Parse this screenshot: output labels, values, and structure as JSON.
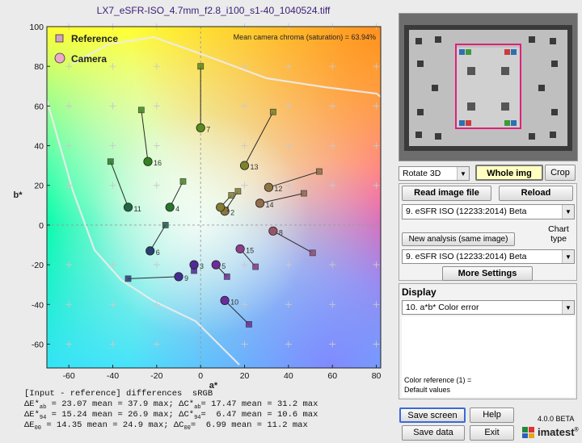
{
  "chart_data": {
    "type": "scatter",
    "title": "LX7_eSFR-ISO_4.7mm_f2.8_i100_s1-40_1040524.tiff",
    "subtitle": "Mean camera chroma (saturation) = 63.94%",
    "xlabel": "a*",
    "ylabel": "b*",
    "xlim": [
      -70,
      82
    ],
    "ylim": [
      -72,
      100
    ],
    "xticks": [
      -60,
      -40,
      -20,
      0,
      20,
      40,
      60,
      80
    ],
    "yticks": [
      100,
      80,
      60,
      40,
      20,
      0,
      -20,
      -40,
      -60
    ],
    "grid": true,
    "legend_placement": "top-left",
    "series": [
      {
        "name": "Reference",
        "marker": "square",
        "points": [
          {
            "x": 0,
            "y": 80
          },
          {
            "x": 33,
            "y": 57
          },
          {
            "x": -27,
            "y": 58
          },
          {
            "x": -8,
            "y": 22
          },
          {
            "x": -41,
            "y": 32
          },
          {
            "x": 17,
            "y": 17
          },
          {
            "x": 54,
            "y": 27
          },
          {
            "x": 47,
            "y": 16
          },
          {
            "x": 14,
            "y": 15
          },
          {
            "x": -16,
            "y": 0
          },
          {
            "x": 51,
            "y": -14
          },
          {
            "x": 25,
            "y": -21
          },
          {
            "x": -3,
            "y": -23
          },
          {
            "x": 12,
            "y": -26
          },
          {
            "x": -33,
            "y": -27
          },
          {
            "x": 22,
            "y": -50
          }
        ]
      },
      {
        "name": "Camera",
        "marker": "circle",
        "points": [
          {
            "x": 0,
            "y": 49,
            "label": "7"
          },
          {
            "x": 20,
            "y": 30,
            "label": "13"
          },
          {
            "x": -24,
            "y": 32,
            "label": "16"
          },
          {
            "x": -14,
            "y": 9,
            "label": "4"
          },
          {
            "x": -33,
            "y": 9,
            "label": "11"
          },
          {
            "x": 11,
            "y": 7,
            "label": "2"
          },
          {
            "x": 31,
            "y": 19,
            "label": "12"
          },
          {
            "x": 27,
            "y": 11,
            "label": "14"
          },
          {
            "x": 9,
            "y": 9,
            "label": "1"
          },
          {
            "x": -23,
            "y": -13,
            "label": "6"
          },
          {
            "x": 33,
            "y": -3,
            "label": "8"
          },
          {
            "x": 18,
            "y": -12,
            "label": "15"
          },
          {
            "x": -3,
            "y": -20,
            "label": "3"
          },
          {
            "x": 7,
            "y": -20,
            "label": "5"
          },
          {
            "x": -10,
            "y": -26,
            "label": "9"
          },
          {
            "x": 11,
            "y": -38,
            "label": "10"
          }
        ]
      }
    ],
    "footer_label": "[Input - reference] differences  sRGB",
    "stats_rows": [
      {
        "left_sym": "ΔE*",
        "left_sub": "ab",
        "left_val": "= 23.07 mean = 37.9 max;",
        "right_sym": "ΔC*",
        "right_sub": "ab",
        "right_val": "= 17.47 mean = 31.2 max"
      },
      {
        "left_sym": "ΔE*",
        "left_sub": "94",
        "left_val": "= 15.24 mean = 26.9 max;",
        "right_sym": "ΔC*",
        "right_sub": "94",
        "right_val": "=  6.47 mean = 10.6 max"
      },
      {
        "left_sym": "ΔE",
        "left_sub": "00",
        "left_val": "= 14.35 mean = 24.9 max;",
        "right_sym": "ΔC",
        "right_sub": "00",
        "right_val": "=  6.99 mean = 11.2 max"
      }
    ]
  },
  "controls": {
    "rotate_select": "Rotate 3D",
    "whole_img": "Whole img",
    "crop": "Crop",
    "read_image_file": "Read image file",
    "reload": "Reload",
    "image_select": "9. eSFR ISO  (12233:2014)  Beta",
    "new_analysis": "New analysis (same image)",
    "chart_type_label": "Chart type",
    "chart_type_select": "9. eSFR ISO  (12233:2014)  Beta",
    "more_settings": "More Settings",
    "display_label": "Display",
    "display_select": "10. a*b* Color error",
    "color_reference_line1": "Color reference (1) =",
    "color_reference_line2": "Default values",
    "save_screen": "Save screen",
    "help": "Help",
    "save_data": "Save data",
    "exit": "Exit",
    "version": "4.0.0 BETA",
    "brand": "imatest",
    "brand_mark": "®"
  },
  "colors": {
    "accent_title": "#3a1c78",
    "whole_img_bg": "#ffffc0",
    "reference_marker": "#d79fc4",
    "camera_marker": "#f0a8cc",
    "selection_box": "#e0207a"
  }
}
